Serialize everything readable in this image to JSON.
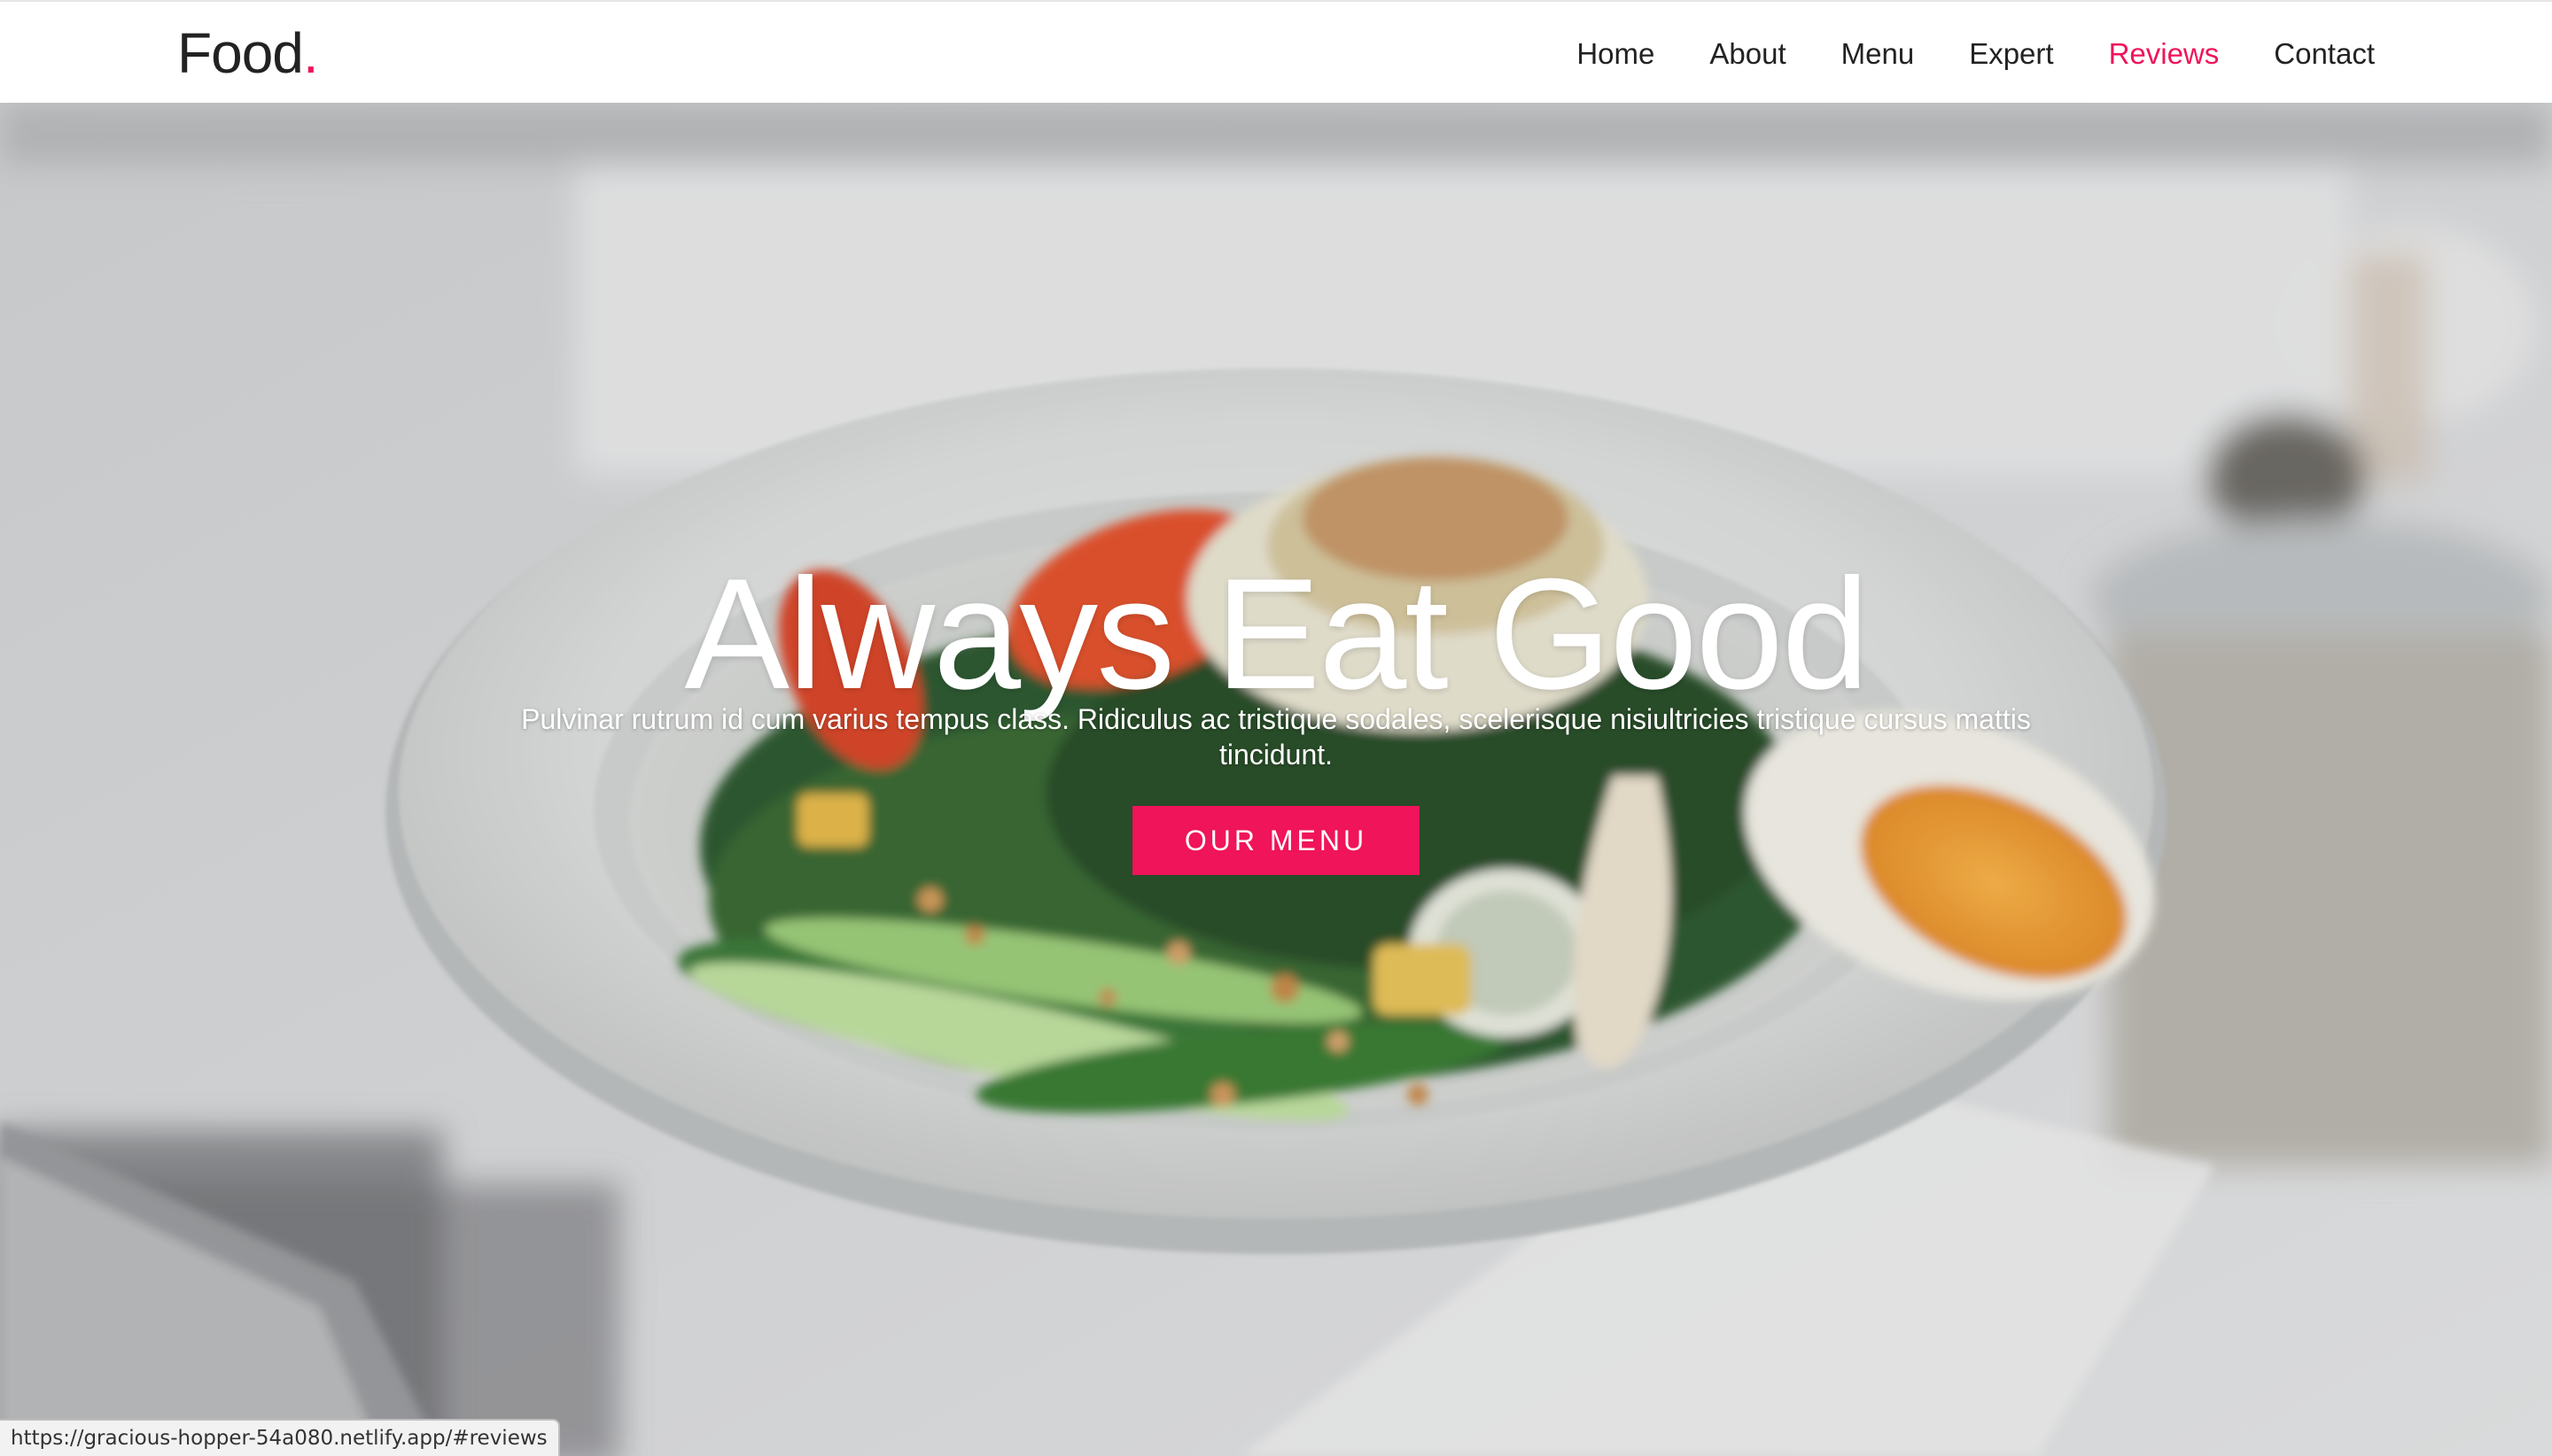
{
  "brand": {
    "name": "Food",
    "dot": "."
  },
  "nav": {
    "items": [
      {
        "label": "Home",
        "active": false
      },
      {
        "label": "About",
        "active": false
      },
      {
        "label": "Menu",
        "active": false
      },
      {
        "label": "Expert",
        "active": false
      },
      {
        "label": "Reviews",
        "active": true
      },
      {
        "label": "Contact",
        "active": false
      }
    ]
  },
  "hero": {
    "title": "Always Eat Good",
    "subtitle": "Pulvinar rutrum id cum varius tempus class. Ridiculus ac tristique sodales, scelerisque nisiultricies tristique cursus mattis tincidunt.",
    "button_label": "OUR MENU",
    "image_subject": "salad-plate-photo"
  },
  "status_bar": {
    "url": "https://gracious-hopper-54a080.netlify.app/#reviews"
  },
  "colors": {
    "accent": "#f0145a",
    "text_dark": "#222222",
    "nav_bg": "#ffffff",
    "hero_text": "#ffffff"
  }
}
